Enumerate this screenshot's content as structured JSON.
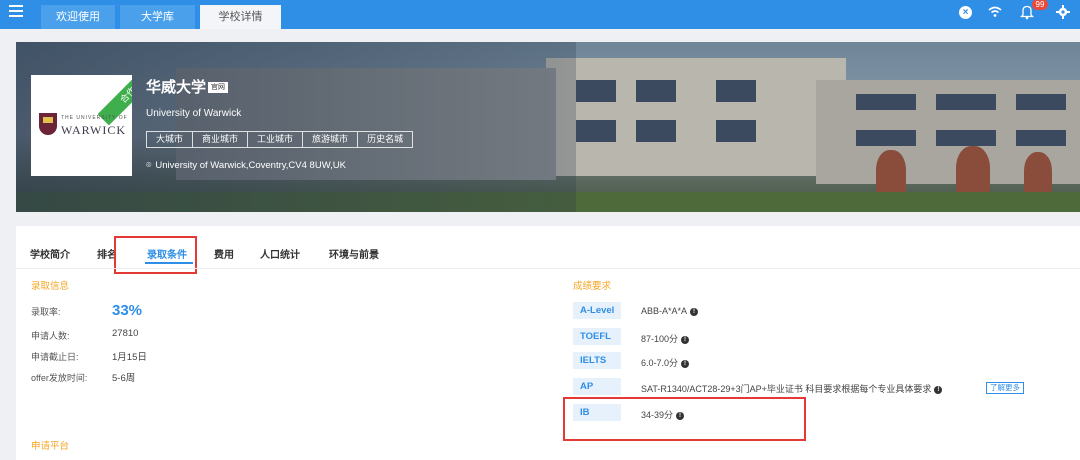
{
  "tabs": [
    {
      "label": "欢迎使用"
    },
    {
      "label": "大学库"
    },
    {
      "label": "学校详情"
    }
  ],
  "topbar_icons": {
    "close": "close-circle-icon",
    "wifi": "wifi-icon",
    "bell": "bell-icon",
    "gear": "gear-icon"
  },
  "notification_count": "99",
  "university": {
    "cooperation_ribbon": "合作",
    "logo_small_text": "THE UNIVERSITY OF",
    "logo_big_text": "WARWICK",
    "cn_name": "华威大学",
    "official_badge": "官网",
    "en_name": "University of Warwick",
    "tags": [
      "大城市",
      "商业城市",
      "工业城市",
      "旅游城市",
      "历史名城"
    ],
    "address": "University of Warwick,Coventry,CV4 8UW,UK"
  },
  "nav": [
    {
      "label": "学校简介"
    },
    {
      "label": "排名"
    },
    {
      "label": "录取条件"
    },
    {
      "label": "费用"
    },
    {
      "label": "人口统计"
    },
    {
      "label": "环境与前景"
    }
  ],
  "admission": {
    "title": "录取信息",
    "rate_label": "录取率:",
    "rate_value": "33%",
    "applicants_label": "申请人数:",
    "applicants_value": "27810",
    "deadline_label": "申请截止日:",
    "deadline_value": "1月15日",
    "offer_label": "offer发放时间:",
    "offer_value": "5-6周"
  },
  "platform_title": "申请平台",
  "scores": {
    "title": "成绩要求",
    "items": [
      {
        "name": "A-Level",
        "value": "ABB-A*A*A"
      },
      {
        "name": "TOEFL",
        "value": "87-100分"
      },
      {
        "name": "IELTS",
        "value": "6.0-7.0分"
      },
      {
        "name": "AP",
        "value": "SAT-R1340/ACT28-29+3门AP+毕业证书 科目要求根据每个专业具体要求"
      },
      {
        "name": "IB",
        "value": "34-39分"
      }
    ],
    "learn_more": "了解更多"
  },
  "colors": {
    "accent": "#2f8ee6",
    "section_title": "#f5a623",
    "highlight": "#e53935"
  }
}
